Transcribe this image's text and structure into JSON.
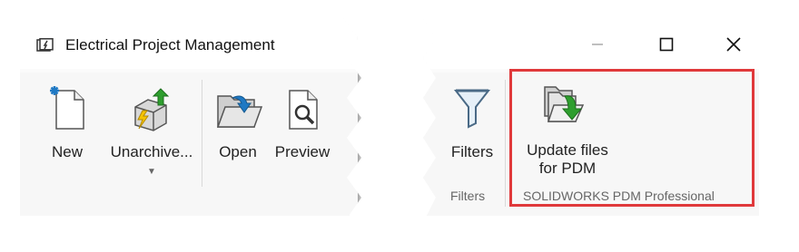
{
  "window": {
    "title": "Electrical Project Management",
    "app_icon": "app-icon"
  },
  "left_ribbon": {
    "buttons": [
      {
        "label": "New",
        "icon": "new-document-icon"
      },
      {
        "label": "Unarchive...",
        "icon": "unarchive-icon",
        "has_dropdown": true
      },
      {
        "label": "Open",
        "icon": "open-folder-icon"
      },
      {
        "label": "Preview",
        "icon": "preview-icon"
      }
    ]
  },
  "right_ribbon": {
    "filters_button": {
      "label": "Filters",
      "icon": "filter-icon"
    },
    "filters_group_label": "Filters",
    "update_button": {
      "label_line1": "Update files",
      "label_line2": "for PDM",
      "icon": "update-files-pdm-icon"
    },
    "pdm_group_label": "SOLIDWORKS PDM Professional"
  },
  "window_controls": [
    "minimize",
    "maximize",
    "close"
  ],
  "colors": {
    "highlight": "#e0393b",
    "arrow_green": "#2e9e2e",
    "accent_blue": "#1f79c4"
  }
}
